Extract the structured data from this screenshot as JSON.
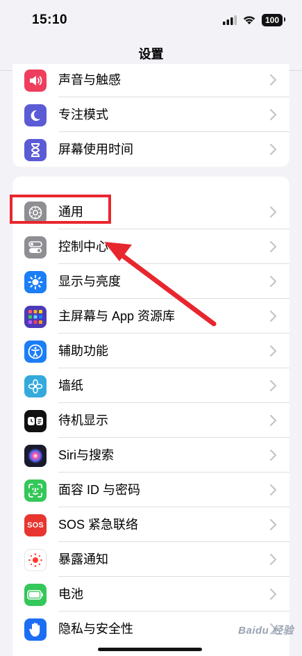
{
  "status": {
    "time": "15:10",
    "battery": "100"
  },
  "nav": {
    "title": "设置"
  },
  "groups": [
    {
      "rows": [
        {
          "label": "声音与触感",
          "icon": "speaker-icon",
          "color": "#ef3e5d"
        },
        {
          "label": "专注模式",
          "icon": "moon-icon",
          "color": "#5b5bd6"
        },
        {
          "label": "屏幕使用时间",
          "icon": "hourglass-icon",
          "color": "#5b5bd6"
        }
      ]
    },
    {
      "rows": [
        {
          "label": "通用",
          "icon": "gear-icon",
          "color": "#8e8e93"
        },
        {
          "label": "控制中心",
          "icon": "toggles-icon",
          "color": "#8e8e93"
        },
        {
          "label": "显示与亮度",
          "icon": "sun-icon",
          "color": "#1c7ef5"
        },
        {
          "label": "主屏幕与 App 资源库",
          "icon": "app-grid-icon",
          "color": "#5a3cc8"
        },
        {
          "label": "辅助功能",
          "icon": "accessibility-icon",
          "color": "#1c7ef5"
        },
        {
          "label": "墙纸",
          "icon": "flower-icon",
          "color": "#34aadc"
        },
        {
          "label": "待机显示",
          "icon": "standby-icon",
          "color": "#111111"
        },
        {
          "label": "Siri与搜索",
          "icon": "siri-icon",
          "color": "#1a1a2e"
        },
        {
          "label": "面容 ID 与密码",
          "icon": "face-id-icon",
          "color": "#34c759"
        },
        {
          "label": "SOS 紧急联络",
          "icon": "sos-icon",
          "color": "#e8352f"
        },
        {
          "label": "暴露通知",
          "icon": "exposure-icon",
          "color": "#ffffff"
        },
        {
          "label": "电池",
          "icon": "battery-icon",
          "color": "#34c759"
        },
        {
          "label": "隐私与安全性",
          "icon": "hand-icon",
          "color": "#1c6ef2"
        }
      ]
    }
  ],
  "icon_texts": {
    "sos": "SOS"
  },
  "annotation": {
    "color": "#e8262e"
  },
  "watermark": "Baidu 经验"
}
